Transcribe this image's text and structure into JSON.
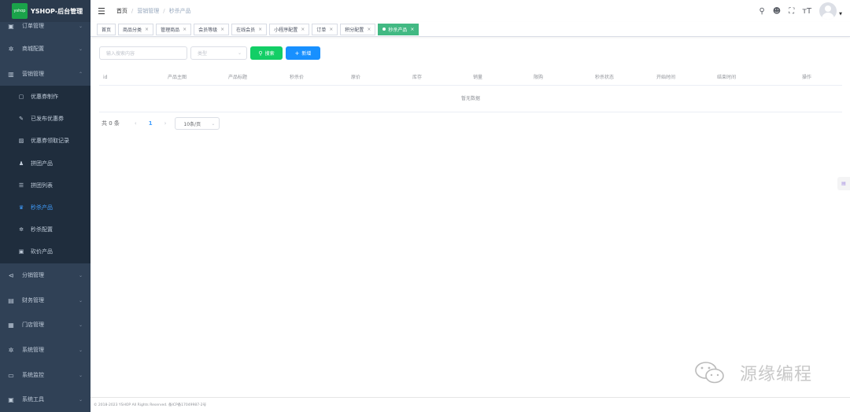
{
  "app": {
    "logo_badge": "yshop",
    "title": "YSHOP-后台管理"
  },
  "sidebar": {
    "items": [
      {
        "label": "订单管理",
        "icon": "order-icon",
        "glyph": "▣"
      },
      {
        "label": "商城配置",
        "icon": "gear-icon",
        "glyph": "✲"
      },
      {
        "label": "营销管理",
        "icon": "chart-icon",
        "glyph": "▥",
        "expanded": true
      },
      {
        "label": "分销管理",
        "icon": "share-icon",
        "glyph": "⊲"
      },
      {
        "label": "财务管理",
        "icon": "finance-icon",
        "glyph": "▤"
      },
      {
        "label": "门店管理",
        "icon": "store-icon",
        "glyph": "▦"
      },
      {
        "label": "系统管理",
        "icon": "system-gear-icon",
        "glyph": "✲"
      },
      {
        "label": "系统监控",
        "icon": "monitor-icon",
        "glyph": "▭"
      },
      {
        "label": "系统工具",
        "icon": "tool-icon",
        "glyph": "▣"
      }
    ],
    "submenu": [
      {
        "label": "优惠券制作",
        "icon": "coupon-icon",
        "glyph": "▢"
      },
      {
        "label": "已发布优惠券",
        "icon": "pencil-icon",
        "glyph": "✎"
      },
      {
        "label": "优惠券领取记录",
        "icon": "record-icon",
        "glyph": "▨"
      },
      {
        "label": "拼团产品",
        "icon": "user-group-icon",
        "glyph": "♟"
      },
      {
        "label": "拼团列表",
        "icon": "list-icon",
        "glyph": "☰"
      },
      {
        "label": "秒杀产品",
        "icon": "tshirt-icon",
        "glyph": "♛",
        "active": true
      },
      {
        "label": "秒杀配置",
        "icon": "config-gear-icon",
        "glyph": "✲"
      },
      {
        "label": "砍价产品",
        "icon": "calendar-icon",
        "glyph": "▣"
      }
    ]
  },
  "header": {
    "breadcrumb": [
      "首页",
      "营销管理",
      "秒杀产品"
    ],
    "tools": [
      {
        "icon": "search-icon",
        "glyph": "⚲"
      },
      {
        "icon": "github-icon",
        "glyph": "☻"
      },
      {
        "icon": "fullscreen-icon",
        "glyph": "⛶"
      },
      {
        "icon": "font-size-icon",
        "glyph": "ᴛT"
      }
    ]
  },
  "tags": [
    {
      "label": "首页",
      "closable": false
    },
    {
      "label": "商品分类",
      "closable": true
    },
    {
      "label": "管理商品",
      "closable": true
    },
    {
      "label": "会员等级",
      "closable": true
    },
    {
      "label": "在线会员",
      "closable": true
    },
    {
      "label": "小程序配置",
      "closable": true
    },
    {
      "label": "订单",
      "closable": true
    },
    {
      "label": "积分配置",
      "closable": true
    },
    {
      "label": "秒杀产品",
      "closable": true,
      "active": true
    }
  ],
  "toolbar": {
    "search_placeholder": "输入搜索内容",
    "type_placeholder": "类型",
    "search_button": "搜索",
    "add_button": "新增"
  },
  "table": {
    "columns": [
      "id",
      "产品主图",
      "产品标题",
      "秒杀价",
      "原价",
      "库存",
      "销量",
      "限购",
      "秒杀状态",
      "开始时间",
      "结束时间",
      "操作"
    ],
    "empty_text": "暂无数据"
  },
  "pagination": {
    "total_text": "共 0 条",
    "current_page": "1",
    "page_size": "10条/页"
  },
  "footer": {
    "text": "© 2018-2023 YSHOP All Rights Reserved. 备ICP备17049987-2号"
  },
  "watermark": {
    "text": "源缘编程"
  },
  "colors": {
    "sidebar_bg": "#304156",
    "sidebar_submenu_bg": "#1f2d3d",
    "active_menu": "#409eff",
    "active_tag": "#42b983",
    "search_button": "#13ce66",
    "add_button": "#1890ff"
  }
}
